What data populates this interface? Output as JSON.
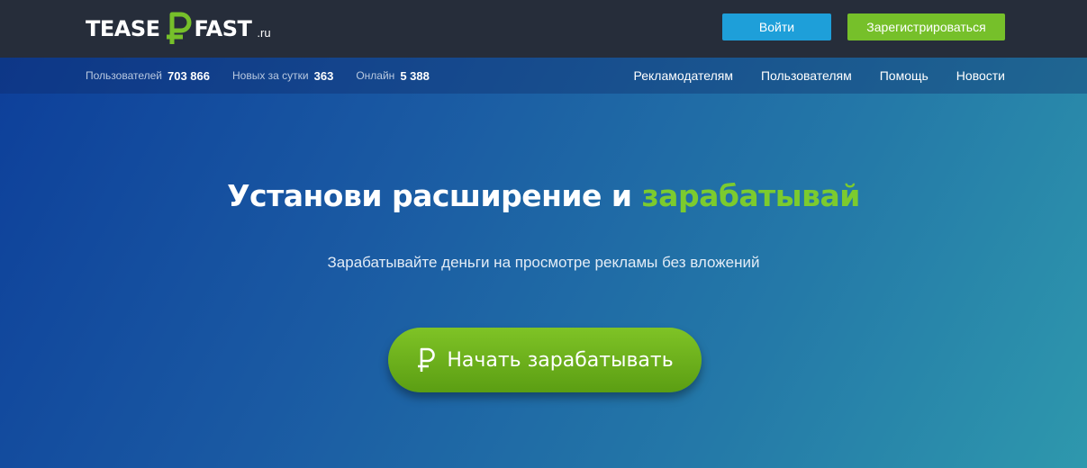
{
  "header": {
    "logo": {
      "word1": "TEASE",
      "word2": "FAST",
      "tld": ".ru"
    },
    "login_label": "Войти",
    "register_label": "Зарегистрироваться"
  },
  "stats": [
    {
      "label": "Пользователей",
      "value": "703 866"
    },
    {
      "label": "Новых за сутки",
      "value": "363"
    },
    {
      "label": "Онлайн",
      "value": "5 388"
    }
  ],
  "nav": [
    {
      "label": "Рекламодателям"
    },
    {
      "label": "Пользователям"
    },
    {
      "label": "Помощь"
    },
    {
      "label": "Новости"
    }
  ],
  "hero": {
    "headline_main": "Установи расширение и",
    "headline_accent": "зарабатывай",
    "subtitle": "Зарабатывайте деньги на просмотре рекламы без вложений",
    "cta_label": "Начать зарабатывать",
    "cta_icon": "ruble-icon"
  },
  "colors": {
    "topbar": "#262d3a",
    "login_button": "#1e9fd9",
    "register_button": "#76c02a",
    "accent_green": "#7ccb2e"
  }
}
